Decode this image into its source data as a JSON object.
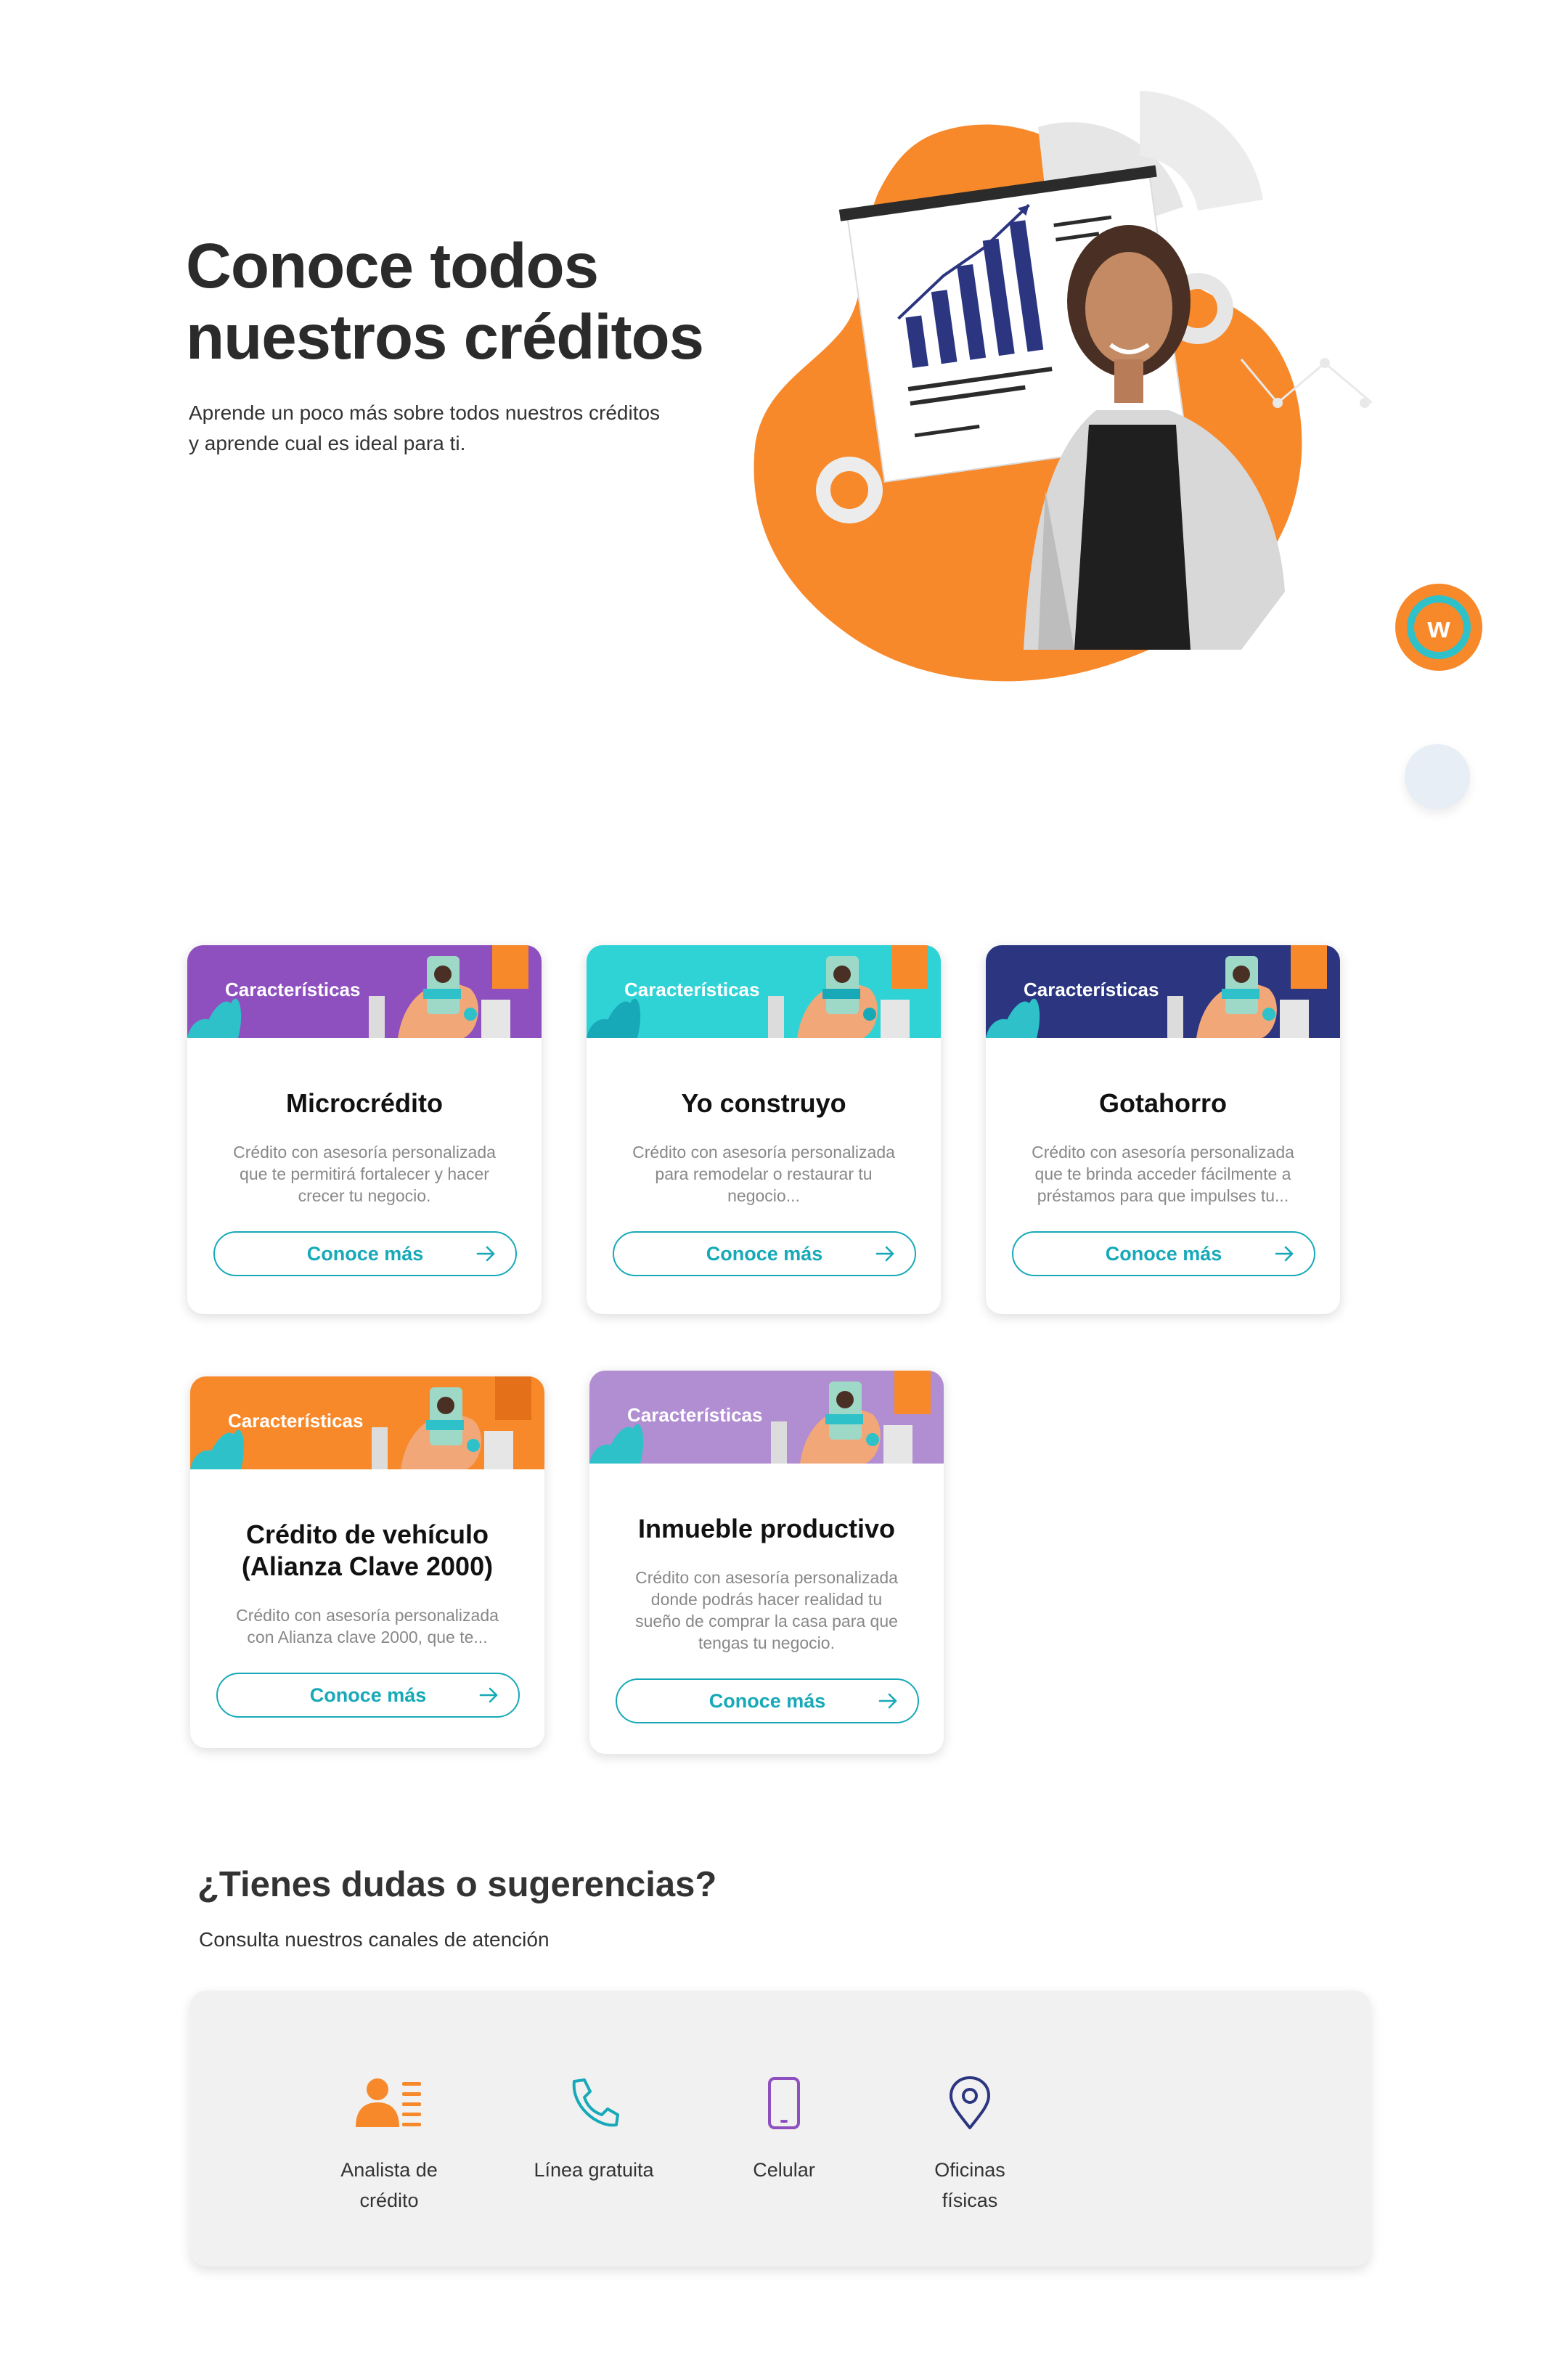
{
  "hero": {
    "title_line1": "Conoce todos",
    "title_line2": "nuestros créditos",
    "subtitle_line1": "Aprende un poco más sobre todos nuestros créditos",
    "subtitle_line2": "y aprende cual es ideal para ti."
  },
  "colors": {
    "orange": "#f7892b",
    "teal": "#17a9b8",
    "purple": "#8e4fbf",
    "cyan": "#2fd3d6",
    "navy": "#2b3580",
    "lavender": "#b18dd1"
  },
  "cards": [
    {
      "banner_label": "Características",
      "title_line1": "Microcrédito",
      "title_line2": "",
      "desc_line1": "Crédito con asesoría personalizada",
      "desc_line2": "que te permitirá fortalecer y hacer",
      "desc_line3": "crecer tu negocio.",
      "desc_line4": "",
      "button": "Conoce más"
    },
    {
      "banner_label": "Características",
      "title_line1": "Yo construyo",
      "title_line2": "",
      "desc_line1": "Crédito con asesoría personalizada",
      "desc_line2": "para remodelar o restaurar tu",
      "desc_line3": "negocio...",
      "desc_line4": "",
      "button": "Conoce más"
    },
    {
      "banner_label": "Características",
      "title_line1": "Gotahorro",
      "title_line2": "",
      "desc_line1": "Crédito con asesoría personalizada",
      "desc_line2": "que te brinda acceder fácilmente a",
      "desc_line3": "préstamos para que impulses tu...",
      "desc_line4": "",
      "button": "Conoce más"
    },
    {
      "banner_label": "Características",
      "title_line1": "Crédito de vehículo",
      "title_line2": "(Alianza Clave 2000)",
      "desc_line1": "Crédito con asesoría personalizada",
      "desc_line2": "con Alianza clave 2000, que te...",
      "desc_line3": "",
      "desc_line4": "",
      "button": "Conoce más"
    },
    {
      "banner_label": "Características",
      "title_line1": "Inmueble productivo",
      "title_line2": "",
      "desc_line1": "Crédito con asesoría personalizada",
      "desc_line2": "donde podrás hacer realidad tu",
      "desc_line3": "sueño de comprar la casa para que",
      "desc_line4": "tengas tu negocio.",
      "button": "Conoce más"
    }
  ],
  "support": {
    "title": "¿Tienes dudas o sugerencias?",
    "subtitle": "Consulta nuestros canales de atención",
    "channels": [
      {
        "label_line1": "Analista de",
        "label_line2": "crédito",
        "icon": "credit-analyst-icon"
      },
      {
        "label_line1": "Línea gratuita",
        "label_line2": "",
        "icon": "phone-icon"
      },
      {
        "label_line1": "Celular",
        "label_line2": "",
        "icon": "mobile-phone-icon"
      },
      {
        "label_line1": "Oficinas",
        "label_line2": "físicas",
        "icon": "location-pin-icon"
      }
    ]
  }
}
